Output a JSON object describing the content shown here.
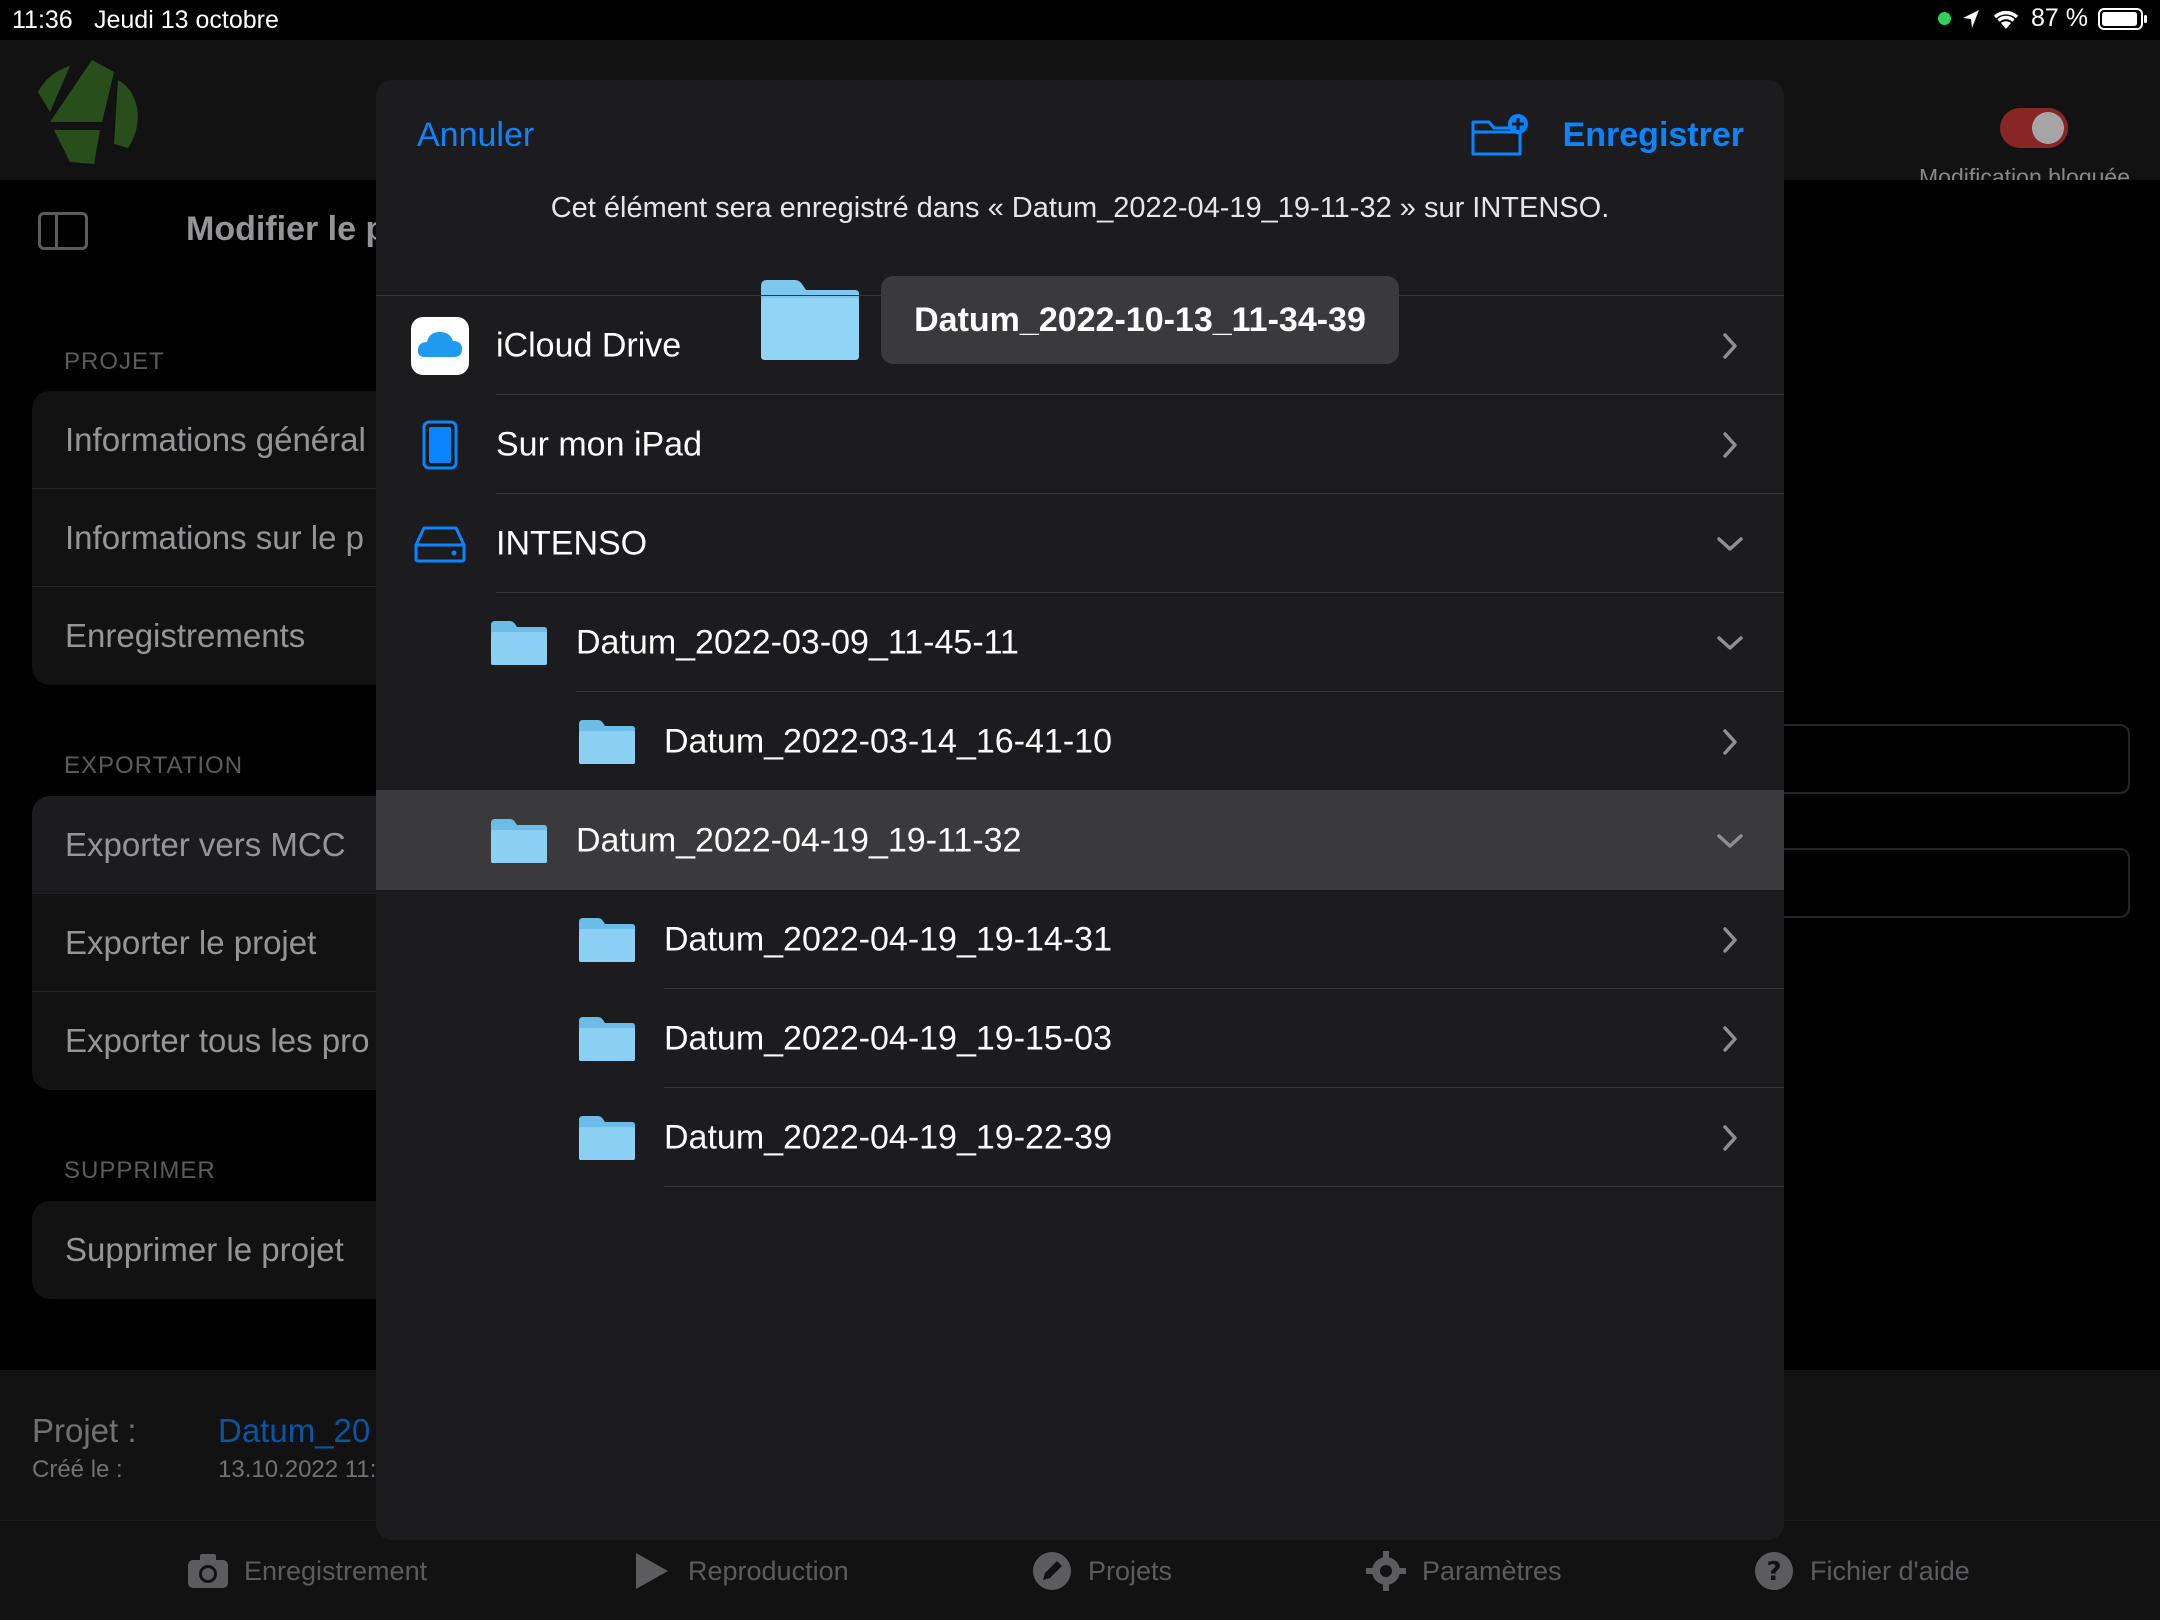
{
  "status_bar": {
    "time": "11:36",
    "date": "Jeudi 13 octobre",
    "battery": "87 %"
  },
  "header": {
    "lock_label": "Modification bloquée"
  },
  "page": {
    "title": "Modifier le p"
  },
  "sections": {
    "projet": {
      "header": "PROJET",
      "items": [
        "Informations général",
        "Informations sur le p",
        "Enregistrements"
      ]
    },
    "exportation": {
      "header": "EXPORTATION",
      "items": [
        "Exporter vers MCC",
        "Exporter le projet",
        "Exporter tous les pro"
      ]
    },
    "supprimer": {
      "header": "SUPPRIMER",
      "items": [
        "Supprimer le projet"
      ]
    }
  },
  "project_info": {
    "project_label": "Projet :",
    "project_value": "Datum_20",
    "created_label": "Créé le :",
    "created_value": "13.10.2022 11:"
  },
  "tabbar": {
    "items": [
      {
        "label": "Enregistrement",
        "icon": "camera-icon"
      },
      {
        "label": "Reproduction",
        "icon": "play-icon"
      },
      {
        "label": "Projets",
        "icon": "pencil-icon"
      },
      {
        "label": "Paramètres",
        "icon": "gear-icon"
      },
      {
        "label": "Fichier d'aide",
        "icon": "help-icon"
      }
    ]
  },
  "modal": {
    "cancel_label": "Annuler",
    "save_label": "Enregistrer",
    "info_text": "Cet élément sera enregistré dans « Datum_2022-04-19_19-11-32 » sur INTENSO.",
    "filename": "Datum_2022-10-13_11-34-39",
    "locations": [
      {
        "label": "iCloud Drive",
        "icon": "icloud-icon",
        "expanded": false
      },
      {
        "label": "Sur mon iPad",
        "icon": "ipad-icon",
        "expanded": false
      },
      {
        "label": "INTENSO",
        "icon": "drive-icon",
        "expanded": true
      }
    ],
    "folders": [
      {
        "label": "Datum_2022-03-09_11-45-11",
        "level": 1,
        "expanded": true,
        "selected": false
      },
      {
        "label": "Datum_2022-03-14_16-41-10",
        "level": 2,
        "expanded": false,
        "selected": false
      },
      {
        "label": "Datum_2022-04-19_19-11-32",
        "level": 1,
        "expanded": true,
        "selected": true
      },
      {
        "label": "Datum_2022-04-19_19-14-31",
        "level": 2,
        "expanded": false,
        "selected": false
      },
      {
        "label": "Datum_2022-04-19_19-15-03",
        "level": 2,
        "expanded": false,
        "selected": false
      },
      {
        "label": "Datum_2022-04-19_19-22-39",
        "level": 2,
        "expanded": false,
        "selected": false
      }
    ]
  },
  "colors": {
    "accent": "#0a84ff",
    "modal_bg": "#1c1c1e",
    "selected_row": "#3a3a3c",
    "folder": "#7ec8ef"
  }
}
